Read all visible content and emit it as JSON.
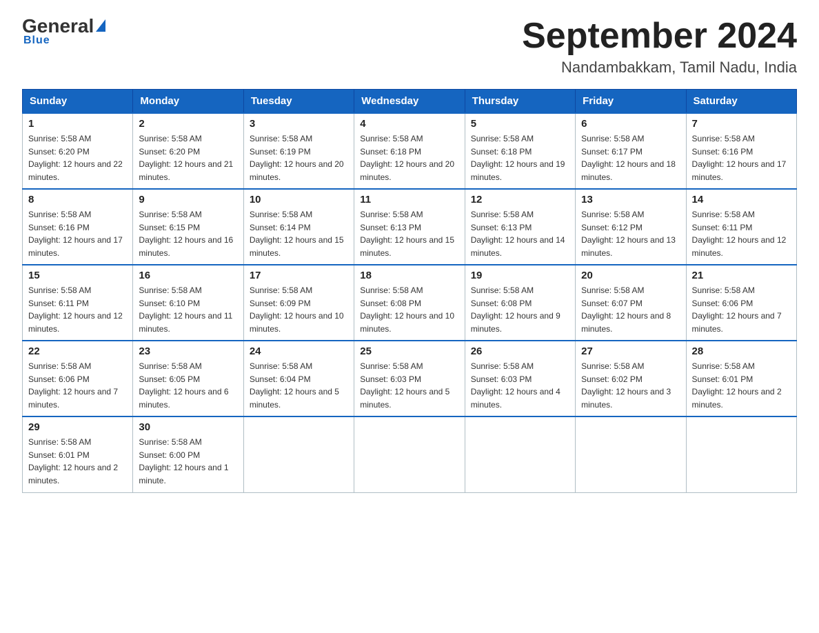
{
  "logo": {
    "general": "General",
    "triangle": "",
    "blue": "Blue"
  },
  "title": {
    "month_year": "September 2024",
    "location": "Nandambakkam, Tamil Nadu, India"
  },
  "headers": [
    "Sunday",
    "Monday",
    "Tuesday",
    "Wednesday",
    "Thursday",
    "Friday",
    "Saturday"
  ],
  "weeks": [
    [
      {
        "day": "1",
        "sunrise": "5:58 AM",
        "sunset": "6:20 PM",
        "daylight": "12 hours and 22 minutes."
      },
      {
        "day": "2",
        "sunrise": "5:58 AM",
        "sunset": "6:20 PM",
        "daylight": "12 hours and 21 minutes."
      },
      {
        "day": "3",
        "sunrise": "5:58 AM",
        "sunset": "6:19 PM",
        "daylight": "12 hours and 20 minutes."
      },
      {
        "day": "4",
        "sunrise": "5:58 AM",
        "sunset": "6:18 PM",
        "daylight": "12 hours and 20 minutes."
      },
      {
        "day": "5",
        "sunrise": "5:58 AM",
        "sunset": "6:18 PM",
        "daylight": "12 hours and 19 minutes."
      },
      {
        "day": "6",
        "sunrise": "5:58 AM",
        "sunset": "6:17 PM",
        "daylight": "12 hours and 18 minutes."
      },
      {
        "day": "7",
        "sunrise": "5:58 AM",
        "sunset": "6:16 PM",
        "daylight": "12 hours and 17 minutes."
      }
    ],
    [
      {
        "day": "8",
        "sunrise": "5:58 AM",
        "sunset": "6:16 PM",
        "daylight": "12 hours and 17 minutes."
      },
      {
        "day": "9",
        "sunrise": "5:58 AM",
        "sunset": "6:15 PM",
        "daylight": "12 hours and 16 minutes."
      },
      {
        "day": "10",
        "sunrise": "5:58 AM",
        "sunset": "6:14 PM",
        "daylight": "12 hours and 15 minutes."
      },
      {
        "day": "11",
        "sunrise": "5:58 AM",
        "sunset": "6:13 PM",
        "daylight": "12 hours and 15 minutes."
      },
      {
        "day": "12",
        "sunrise": "5:58 AM",
        "sunset": "6:13 PM",
        "daylight": "12 hours and 14 minutes."
      },
      {
        "day": "13",
        "sunrise": "5:58 AM",
        "sunset": "6:12 PM",
        "daylight": "12 hours and 13 minutes."
      },
      {
        "day": "14",
        "sunrise": "5:58 AM",
        "sunset": "6:11 PM",
        "daylight": "12 hours and 12 minutes."
      }
    ],
    [
      {
        "day": "15",
        "sunrise": "5:58 AM",
        "sunset": "6:11 PM",
        "daylight": "12 hours and 12 minutes."
      },
      {
        "day": "16",
        "sunrise": "5:58 AM",
        "sunset": "6:10 PM",
        "daylight": "12 hours and 11 minutes."
      },
      {
        "day": "17",
        "sunrise": "5:58 AM",
        "sunset": "6:09 PM",
        "daylight": "12 hours and 10 minutes."
      },
      {
        "day": "18",
        "sunrise": "5:58 AM",
        "sunset": "6:08 PM",
        "daylight": "12 hours and 10 minutes."
      },
      {
        "day": "19",
        "sunrise": "5:58 AM",
        "sunset": "6:08 PM",
        "daylight": "12 hours and 9 minutes."
      },
      {
        "day": "20",
        "sunrise": "5:58 AM",
        "sunset": "6:07 PM",
        "daylight": "12 hours and 8 minutes."
      },
      {
        "day": "21",
        "sunrise": "5:58 AM",
        "sunset": "6:06 PM",
        "daylight": "12 hours and 7 minutes."
      }
    ],
    [
      {
        "day": "22",
        "sunrise": "5:58 AM",
        "sunset": "6:06 PM",
        "daylight": "12 hours and 7 minutes."
      },
      {
        "day": "23",
        "sunrise": "5:58 AM",
        "sunset": "6:05 PM",
        "daylight": "12 hours and 6 minutes."
      },
      {
        "day": "24",
        "sunrise": "5:58 AM",
        "sunset": "6:04 PM",
        "daylight": "12 hours and 5 minutes."
      },
      {
        "day": "25",
        "sunrise": "5:58 AM",
        "sunset": "6:03 PM",
        "daylight": "12 hours and 5 minutes."
      },
      {
        "day": "26",
        "sunrise": "5:58 AM",
        "sunset": "6:03 PM",
        "daylight": "12 hours and 4 minutes."
      },
      {
        "day": "27",
        "sunrise": "5:58 AM",
        "sunset": "6:02 PM",
        "daylight": "12 hours and 3 minutes."
      },
      {
        "day": "28",
        "sunrise": "5:58 AM",
        "sunset": "6:01 PM",
        "daylight": "12 hours and 2 minutes."
      }
    ],
    [
      {
        "day": "29",
        "sunrise": "5:58 AM",
        "sunset": "6:01 PM",
        "daylight": "12 hours and 2 minutes."
      },
      {
        "day": "30",
        "sunrise": "5:58 AM",
        "sunset": "6:00 PM",
        "daylight": "12 hours and 1 minute."
      },
      null,
      null,
      null,
      null,
      null
    ]
  ]
}
